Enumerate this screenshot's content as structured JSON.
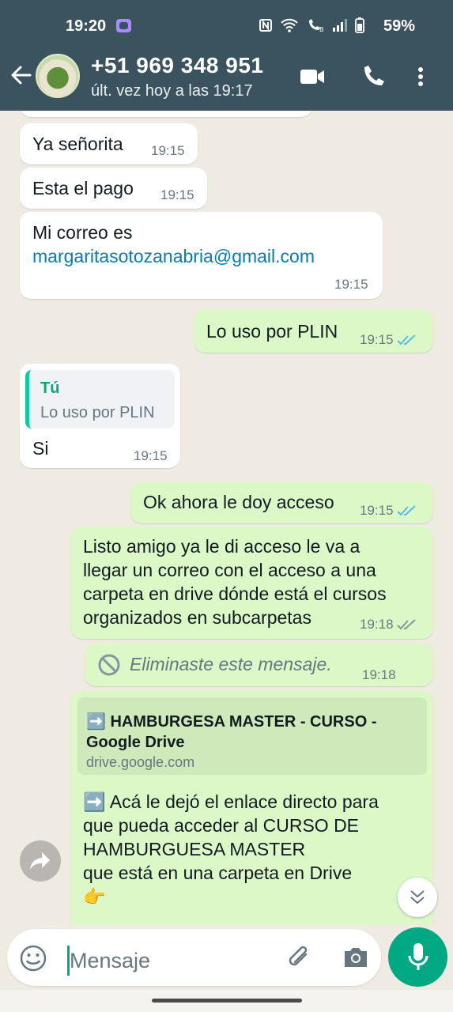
{
  "status_bar": {
    "time": "19:20",
    "battery": "59%"
  },
  "header": {
    "contact_name": "+51 969 348 951",
    "last_seen": "últ. vez hoy a las 19:17"
  },
  "messages": [
    {
      "text": "Ya señorita",
      "time": "19:15"
    },
    {
      "text": "Esta el pago",
      "time": "19:15"
    },
    {
      "text_line1": "Mi correo es",
      "email": "margaritasotozanabria@gmail.com",
      "time": "19:15"
    },
    {
      "text": "Lo uso por PLIN",
      "time": "19:15"
    },
    {
      "quote_author": "Tú",
      "quote_text": "Lo uso por PLIN",
      "text": "Si",
      "time": "19:15"
    },
    {
      "text": "Ok ahora le doy acceso",
      "time": "19:15"
    },
    {
      "lines": [
        "Listo amigo ya le di acceso le va a",
        "llegar un correo con el acceso a una",
        "carpeta en drive dónde está el cursos",
        "organizados en subcarpetas"
      ],
      "time": "19:18"
    },
    {
      "text": "Eliminaste este mensaje.",
      "time": "19:18"
    },
    {
      "preview_title_line1": "➡️ HAMBURGESA MASTER - CURSO -",
      "preview_title_line2": "Google Drive",
      "preview_domain": "drive.google.com",
      "lines": [
        "➡️ Acá le dejó el enlace directo para",
        "que pueda acceder al CURSO DE",
        "HAMBURGUESA MASTER",
        "que está en una carpeta en Drive",
        "👉"
      ]
    }
  ],
  "input": {
    "placeholder": "Mensaje"
  },
  "colors": {
    "header": "#3b535f",
    "outgoing": "#dcf8c6",
    "incoming": "#ffffff",
    "accent": "#00a884",
    "link": "#027eb5",
    "read_ticks": "#53bdeb"
  }
}
